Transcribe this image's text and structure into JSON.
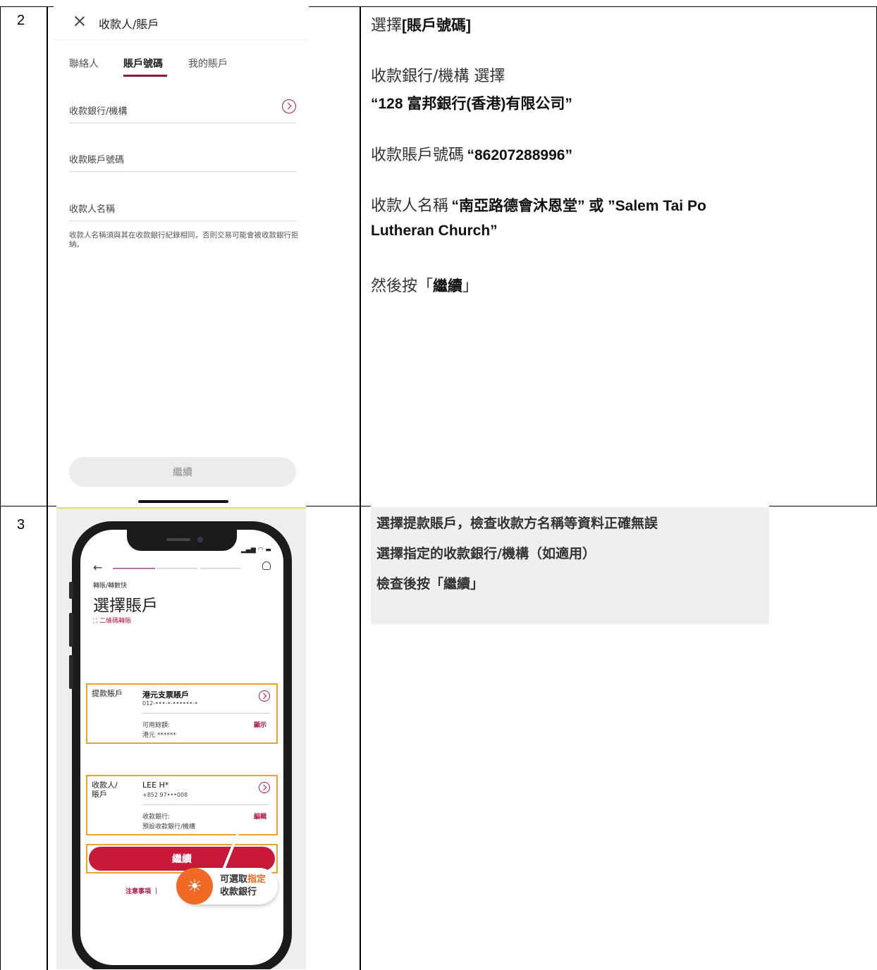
{
  "rows": [
    {
      "step": "2",
      "screen": {
        "title": "收款人/賬戶",
        "tabs": [
          "聯絡人",
          "賬戶號碼",
          "我的賬戶"
        ],
        "active_tab": "賬戶號碼",
        "fields": [
          "收款銀行/機構",
          "收款賬戶號碼",
          "收款人名稱"
        ],
        "note": "收款人名稱須與其在收款銀行紀錄相同，否則交易可能會被收款銀行拒納。",
        "continue_label": "繼續"
      },
      "instructions": {
        "line1_light": "選擇",
        "line1_bold": "[賬戶號碼]",
        "line2_light": "收款銀行/機構 選擇",
        "line3_bold": "“128 富邦銀行(香港)有限公司”",
        "line4_light": "收款賬戶號碼",
        "line4_bold": "“86207288996”",
        "line5_light": "收款人名稱",
        "line5_bold": "“南亞路德會沐恩堂” 或 ”Salem Tai Po",
        "line6_bold": "Lutheran Church”",
        "line7_light_a": "然後按「",
        "line7_bold": "繼續",
        "line7_light_b": "」"
      }
    },
    {
      "step": "3",
      "screen": {
        "breadcrumb": "轉賬/轉數快",
        "title": "選擇賬戶",
        "qr_link": "二維碼轉賬",
        "debit": {
          "label": "提款賬戶",
          "account_name": "港元支票賬戶",
          "account_no": "012-•••-•-••••••-•",
          "balance_label": "可用餘額:",
          "balance_value": "港元 ******",
          "action": "顯示"
        },
        "payee": {
          "label_a": "收款人/",
          "label_b": "賬戶",
          "name": "LEE H*",
          "phone": "+852 97•••008",
          "bank_label": "收款銀行:",
          "bank_value": "預設收款銀行/機構",
          "action": "編輯"
        },
        "continue_label": "繼續",
        "footer_link": "注意事項",
        "callout_a": "可選取",
        "callout_hl": "指定",
        "callout_b": "收款銀行"
      },
      "instructions": [
        "選擇提款賬戶，檢查收款方名稱等資料正確無誤",
        "選擇指定的收款銀行/機構（如適用）",
        "檢查後按「繼續」"
      ]
    }
  ]
}
